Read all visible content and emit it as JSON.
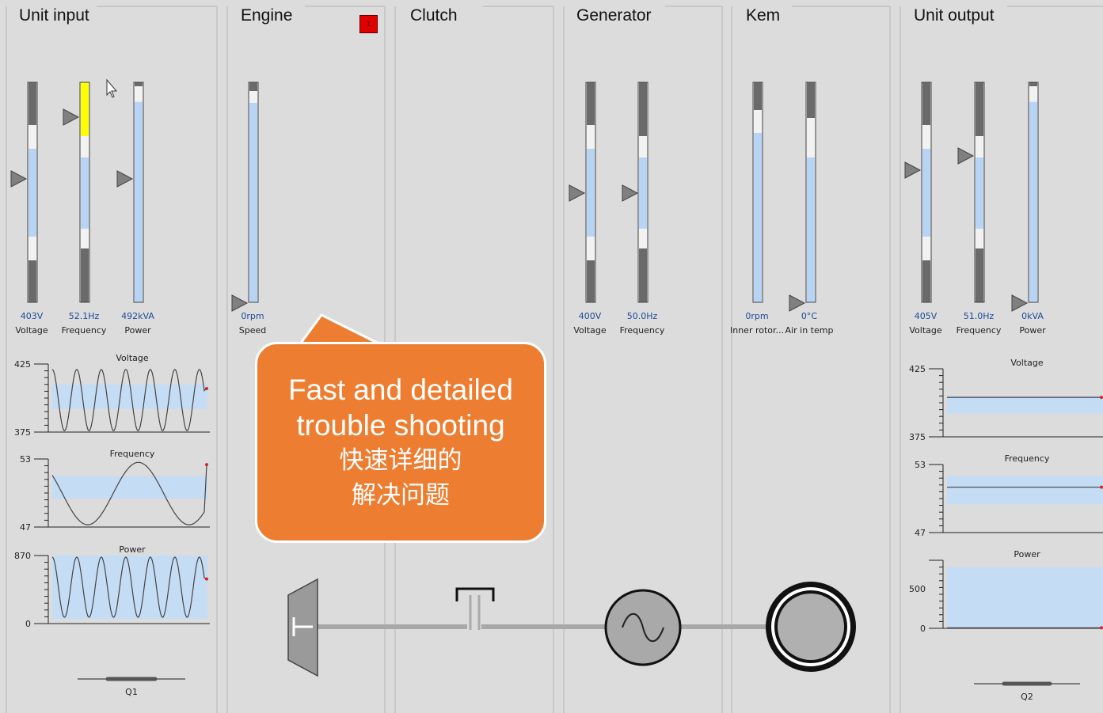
{
  "panels": [
    {
      "title": "Unit input"
    },
    {
      "title": "Engine"
    },
    {
      "title": "Clutch"
    },
    {
      "title": "Generator"
    },
    {
      "title": "Kem"
    },
    {
      "title": "Unit output"
    }
  ],
  "engine_alarm": {
    "label": "1",
    "color": "#e00000"
  },
  "gauges": [
    {
      "panel": "Unit input",
      "value": "403V",
      "label": "Voltage",
      "fill": 0.7,
      "highlight": "none"
    },
    {
      "panel": "Unit input",
      "value": "52.1Hz",
      "label": "Frequency",
      "fill": 0.85,
      "highlight": "yellow"
    },
    {
      "panel": "Unit input",
      "value": "492kVA",
      "label": "Power",
      "fill": 0.91,
      "highlight": "none"
    },
    {
      "panel": "Engine",
      "value": "0rpm",
      "label": "Speed",
      "fill": 0.91,
      "highlight": "none"
    },
    {
      "panel": "Generator",
      "value": "400V",
      "label": "Voltage",
      "fill": 0.7,
      "highlight": "none"
    },
    {
      "panel": "Generator",
      "value": "50.0Hz",
      "label": "Frequency",
      "fill": 0.66,
      "highlight": "none"
    },
    {
      "panel": "Kem",
      "value": "0rpm",
      "label": "Inner rotor...",
      "fill": 0.77,
      "highlight": "none"
    },
    {
      "panel": "Kem",
      "value": "0°C",
      "label": "Air in temp",
      "fill": 0.66,
      "highlight": "none"
    },
    {
      "panel": "Unit output",
      "value": "405V",
      "label": "Voltage",
      "fill": 0.7,
      "highlight": "none"
    },
    {
      "panel": "Unit output",
      "value": "51.0Hz",
      "label": "Frequency",
      "fill": 0.66,
      "highlight": "none"
    },
    {
      "panel": "Unit output",
      "value": "0kVA",
      "label": "Power",
      "fill": 0.91,
      "highlight": "none"
    }
  ],
  "chart_data": [
    {
      "type": "line",
      "title": "Voltage",
      "panel": "Unit input",
      "ylim": [
        375,
        425
      ],
      "yticks": [
        "425",
        "375"
      ],
      "band": [
        392,
        410
      ],
      "series": [
        {
          "pattern": "sine",
          "cycles": 6.2,
          "min": 376,
          "max": 421,
          "last": 407
        }
      ]
    },
    {
      "type": "line",
      "title": "Frequency",
      "panel": "Unit input",
      "ylim": [
        47,
        53
      ],
      "yticks": [
        "53",
        "47"
      ],
      "band": [
        49.5,
        51.5
      ],
      "series": [
        {
          "pattern": "slow-sine",
          "cycles": 1.5,
          "min": 47.2,
          "max": 52.7,
          "last": 52.5
        }
      ]
    },
    {
      "type": "line",
      "title": "Power",
      "panel": "Unit input",
      "ylim": [
        0,
        870
      ],
      "yticks": [
        "870",
        "0"
      ],
      "band": [
        60,
        870
      ],
      "series": [
        {
          "pattern": "sine",
          "cycles": 6.2,
          "min": 80,
          "max": 850,
          "last": 570
        }
      ]
    },
    {
      "type": "line",
      "title": "Voltage",
      "panel": "Unit output",
      "ylim": [
        375,
        425
      ],
      "yticks": [
        "425",
        "375"
      ],
      "band": [
        392,
        405
      ],
      "series": [
        {
          "pattern": "flat",
          "value": 404
        }
      ]
    },
    {
      "type": "line",
      "title": "Frequency",
      "panel": "Unit output",
      "ylim": [
        47,
        53
      ],
      "yticks": [
        "53",
        "47"
      ],
      "band": [
        49.5,
        52
      ],
      "series": [
        {
          "pattern": "flat",
          "value": 51.0
        }
      ]
    },
    {
      "type": "line",
      "title": "Power",
      "panel": "Unit output",
      "ylim": [
        0,
        700
      ],
      "yticks": [
        "500",
        "0"
      ],
      "band": [
        10,
        630
      ],
      "series": [
        {
          "pattern": "flat",
          "value": 5
        }
      ]
    }
  ],
  "breakers": [
    {
      "label": "Q1"
    },
    {
      "label": "Q2"
    }
  ],
  "callout": {
    "line1": "Fast and detailed",
    "line2": "trouble shooting",
    "line3": "快速详细的",
    "line4": "解决问题"
  },
  "colors": {
    "band": "#c5dcf5",
    "gauge_fill": "#b8d4f5",
    "gauge_dark": "#6a6a6a",
    "callout": "#ed7d31",
    "marker": "#e02020"
  }
}
